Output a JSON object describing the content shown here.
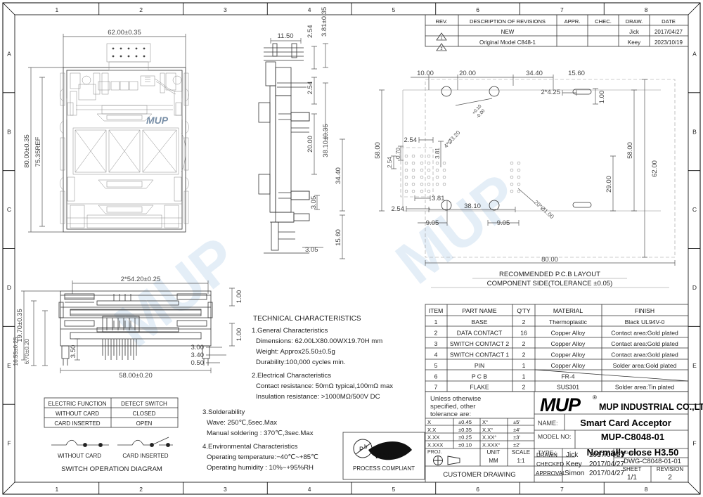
{
  "sheet": {
    "zones_top": [
      "1",
      "2",
      "3",
      "4",
      "5",
      "6",
      "7",
      "8"
    ],
    "zones_bottom": [
      "1",
      "2",
      "3",
      "4",
      "5",
      "6",
      "7",
      "8"
    ],
    "zones_left": [
      "A",
      "B",
      "C",
      "D",
      "E",
      "F"
    ],
    "zones_right": [
      "A",
      "B",
      "C",
      "D",
      "E",
      "F"
    ],
    "watermark": "MUP"
  },
  "revision_table": {
    "headers": [
      "REV.",
      "DESCRIPTION OF REVISIONS",
      "APPR.",
      "CHEC.",
      "DRAW.",
      "DATE"
    ],
    "rows": [
      {
        "rev": "1",
        "description": "NEW",
        "appr": "",
        "chec": "",
        "draw": "Jick",
        "date": "2017/04/27"
      },
      {
        "rev": "2",
        "description": "Original Model C848-1",
        "appr": "",
        "chec": "",
        "draw": "Keey",
        "date": "2023/10/19"
      }
    ]
  },
  "top_view": {
    "dim_width": "62.00±0.35",
    "dim_height": "80.00±0.35",
    "dim_ref": "75.35REF",
    "logo": "MUP"
  },
  "side_view": {
    "dim_11_50": "11.50",
    "dim_2_54_top": "2.54",
    "dim_3_81": "3.81±0.35",
    "dim_2_54_mid": "2.54",
    "dim_20_00": "20.00",
    "dim_38_10": "38.10±0.35",
    "dim_34_40": "34.40",
    "dim_3_05_a": "3.05",
    "dim_3_05_b": "3.05",
    "dim_15_60": "15.60"
  },
  "front_view": {
    "dim_2x54_20": "2*54.20±0.25",
    "dim_19_70": "19.70±0.35",
    "dim_16_55": "16.55±0.25",
    "dim_6_70": "6.70±0.20",
    "dim_3_50": "3.50",
    "dim_58_00": "58.00±0.20",
    "dim_1_00_top": "1.00",
    "dim_1_00_bot": "1.00",
    "dim_3_00": "3.00",
    "dim_3_40": "3.40",
    "dim_0_50": "0.50"
  },
  "pcb_layout": {
    "title_line1": "RECOMMENDED P.C.B LAYOUT",
    "title_line2": "COMPONENT SIDE(TOLERANCE ±0.05)",
    "dim_10_00": "10.00",
    "dim_20_00": "20.00",
    "dim_34_40": "34.40",
    "dim_15_60": "15.60",
    "dim_2x4_25": "2*4.25",
    "dim_1_00": "1.00",
    "hole_note_4": "4*Ø3.20+0.10-0.00",
    "hole_note_20": "20*Ø1.00",
    "dim_2_54_a": "2.54",
    "dim_2_54_b": "2.54",
    "dim_2_54_c": "2.54",
    "dim_0_70": "0.70",
    "dim_3_81_a": "3.81",
    "dim_3_81_b": "3.81",
    "dim_38_10": "38.10",
    "dim_9_05_a": "9.05",
    "dim_9_05_b": "9.05",
    "dim_58_00_l": "58.00",
    "dim_58_00_r": "58.00",
    "dim_62_00": "62.00",
    "dim_29_00": "29.00",
    "dim_80_00": "80.00"
  },
  "technical": {
    "title": "TECHNICAL CHARACTERISTICS",
    "sections": [
      {
        "heading": "1.General Characteristics",
        "lines": [
          "Dimensions: 62.00LX80.00WX19.70H  mm",
          "Weight: Approx25.50±0.5g",
          "Durability:100,000  cycles  min."
        ]
      },
      {
        "heading": "2.Electrical Characteristics",
        "lines": [
          "Contact resistance: 50mΩ typical,100mΩ max",
          "Insulation resistance: >1000MΩ/500V DC"
        ]
      },
      {
        "heading": "3.Solderability",
        "lines": [
          "Wave: 250℃,5sec.Max",
          "Manual soldering : 370℃,3sec.Max"
        ]
      },
      {
        "heading": "4.Environmental Characteristics",
        "lines": [
          "Operating temperature:−40℃~+85℃",
          "Operating humidity : 10%~+95%RH"
        ]
      }
    ]
  },
  "switch_table": {
    "headers": [
      "ELECTRIC FUNCTION",
      "DETECT SWITCH"
    ],
    "rows": [
      [
        "WITHOUT CARD",
        "CLOSED"
      ],
      [
        "CARD INSERTED",
        "OPEN"
      ]
    ],
    "diagram_label_left": "WITHOUT CARD",
    "diagram_label_right": "CARD INSERTED",
    "diagram_title": "SWITCH OPERATION DIAGRAM"
  },
  "rohs": {
    "mark": "RoHS",
    "sub": "PROCESS COMPLIANT",
    "pb": "P/b"
  },
  "parts_table": {
    "headers": [
      "ITEM",
      "PART NAME",
      "Q'TY",
      "MATERIAL",
      "FINISH"
    ],
    "rows": [
      [
        "1",
        "BASE",
        "2",
        "Thermoplastic",
        "Black UL94V-0"
      ],
      [
        "2",
        "DATA CONTACT",
        "16",
        "Copper Alloy",
        "Contact area:Gold plated"
      ],
      [
        "3",
        "SWITCH CONTACT 2",
        "2",
        "Copper Alloy",
        "Contact area:Gold plated"
      ],
      [
        "4",
        "SWITCH CONTACT 1",
        "2",
        "Copper Alloy",
        "Contact area:Gold plated"
      ],
      [
        "5",
        "PIN",
        "1",
        "Copper Alloy",
        "Solder area:Gold plated"
      ],
      [
        "6",
        "P C B",
        "1",
        "FR-4",
        ""
      ],
      [
        "7",
        "FLAKE",
        "2",
        "SUS301",
        "Solder area:Tin plated"
      ]
    ]
  },
  "tolerance_block": {
    "text_line1": "Unless  otherwise",
    "text_line2": "specified,  other",
    "text_line3": "tolerance  are:",
    "rows": [
      [
        "X",
        "±0.45",
        "X°",
        "±5'"
      ],
      [
        "X.X",
        "±0.35",
        "X.X°",
        "±4'"
      ],
      [
        "X.XX",
        "±0.25",
        "X.XX°",
        "±3'"
      ],
      [
        "X.XXX",
        "±0.10",
        "X.XXX°",
        "±2'"
      ]
    ],
    "proj_label": "PROJ.",
    "unit_label": "UNIT",
    "unit_value": "MM",
    "scale_label": "SCALE",
    "scale_value": "1:1",
    "customer_drawing": "CUSTOMER  DRAWING"
  },
  "title_block": {
    "logo": "MUP",
    "registered": "®",
    "company": "MUP INDUSTRIAL CO.,LTD.",
    "name_label": "NAME:",
    "name_value": "Smart Card Acceptor",
    "model_label": "MODEL NO:",
    "model_value": "MUP-C8048-01",
    "type_label": "TYPE :",
    "type_value": "Normally close H3.50",
    "drawn_label": "DRAWN",
    "drawn_by": "Jick",
    "drawn_date": "2017/04/27",
    "checked_label": "CHECKED",
    "checked_by": "Keey",
    "checked_date": "2017/04/27",
    "approval_label": "APPROVAL",
    "approval_by": "Simon",
    "approval_date": "2017/04/27",
    "dwg_label": "DWG NO. :",
    "dwg_value": "DWG-C8048-01-01",
    "sheet_label": "SHEET",
    "sheet_value": "1/1",
    "revision_label": "REVISION",
    "revision_value": "2"
  }
}
